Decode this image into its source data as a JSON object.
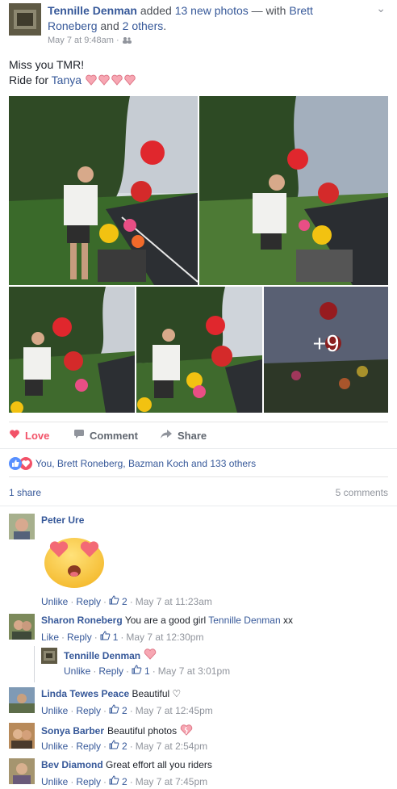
{
  "post": {
    "author": "Tennille Denman",
    "added_text": "added",
    "photos_link": "13 new photos",
    "with_text": "— with",
    "tagged_1": "Brett Roneberg",
    "and_text": "and",
    "others_link": "2 others",
    "period": ".",
    "timestamp": "May 7 at 9:48am",
    "line1": "Miss you TMR!",
    "line2_prefix": "Ride for",
    "line2_link": "Tanya",
    "more_photos": "+9"
  },
  "actions": {
    "love": "Love",
    "comment": "Comment",
    "share": "Share"
  },
  "reactions": {
    "text": "You, Brett Roneberg, Bazman Koch and 133 others"
  },
  "stats": {
    "shares": "1 share",
    "comments": "5 comments"
  },
  "comments": [
    {
      "name": "Peter Ure",
      "text": "",
      "unlike": "Unlike",
      "reply": "Reply",
      "likes": "2",
      "time": "May 7 at 11:23am"
    },
    {
      "name": "Sharon Roneberg",
      "text": "You are a good girl",
      "mention": "Tennille Denman",
      "suffix": "xx",
      "like": "Like",
      "reply": "Reply",
      "likes": "1",
      "time": "May 7 at 12:30pm"
    },
    {
      "name": "Tennille Denman",
      "text": "",
      "unlike": "Unlike",
      "reply": "Reply",
      "likes": "1",
      "time": "May 7 at 3:01pm"
    },
    {
      "name": "Linda Tewes Peace",
      "text": "Beautiful ♡",
      "unlike": "Unlike",
      "reply": "Reply",
      "likes": "2",
      "time": "May 7 at 12:45pm"
    },
    {
      "name": "Sonya Barber",
      "text": "Beautiful photos",
      "unlike": "Unlike",
      "reply": "Reply",
      "likes": "2",
      "time": "May 7 at 2:54pm"
    },
    {
      "name": "Bev Diamond",
      "text": "Great effort all you riders",
      "unlike": "Unlike",
      "reply": "Reply",
      "likes": "2",
      "time": "May 7 at 7:45pm"
    }
  ],
  "colors": {
    "link": "#365899",
    "love": "#f25268",
    "meta": "#90949c"
  }
}
